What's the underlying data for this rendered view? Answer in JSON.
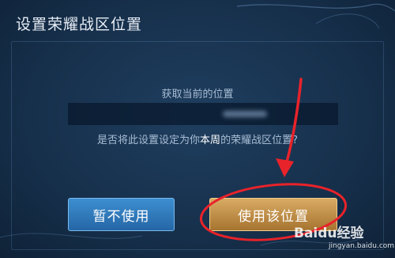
{
  "dialog": {
    "title": "设置荣耀战区位置",
    "subtitle": "获取当前的位置",
    "question_prefix": "是否将此设置设定为你",
    "question_highlight": "本周",
    "question_suffix": "的荣耀战区位置?"
  },
  "buttons": {
    "cancel_label": "暂不使用",
    "confirm_label": "使用该位置"
  },
  "watermark": {
    "brand": "Baidu经验",
    "url": "jingyan.baidu.com"
  },
  "colors": {
    "cancel_button": "#2e7bbf",
    "confirm_button": "#c4914a",
    "annotation": "#e8232a"
  }
}
